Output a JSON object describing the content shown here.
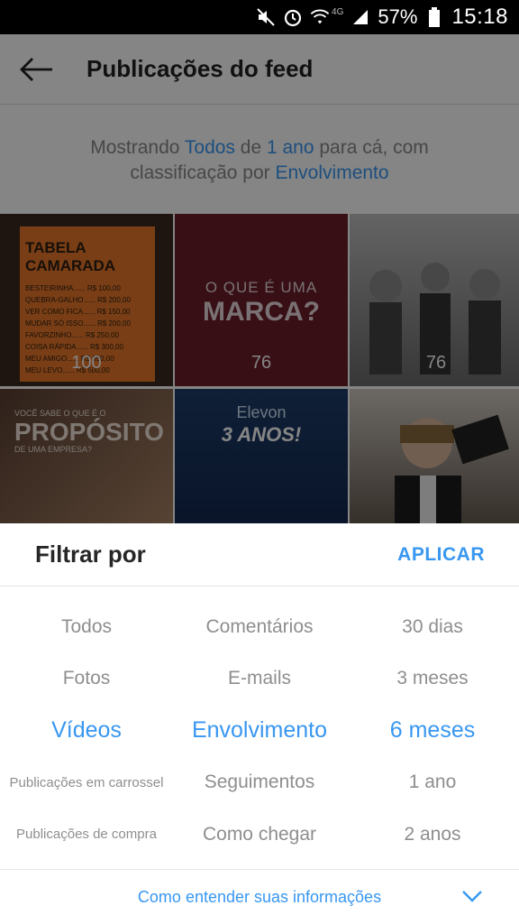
{
  "status_bar": {
    "time": "15:18",
    "battery": "57%",
    "network": "4G",
    "icons": [
      "mute-icon",
      "alarm-icon",
      "wifi-icon",
      "signal-icon",
      "battery-icon"
    ]
  },
  "header": {
    "title": "Publicações do feed",
    "back_icon": "arrow-left-icon"
  },
  "summary": {
    "prefix": "Mostrando ",
    "type": "Todos",
    "middle1": " de ",
    "period": "1 ano",
    "middle2": " para cá, com classificação por ",
    "sort": "Envolvimento"
  },
  "posts": [
    {
      "count": "100",
      "title": "TABELA CAMARADA",
      "rows": [
        "BESTEIRINHA...... R$ 100,00",
        "QUEBRA-GALHO...... R$ 200,00",
        "VER COMO FICA...... R$ 150,00",
        "MUDAR SÓ ISSO...... R$ 200,00",
        "FAVORZINHO...... R$ 250,00",
        "COISA RÁPIDA...... R$ 300,00",
        "MEU AMIGO...... R$ 350,00",
        "MEU LEVO...... R$ 500,00"
      ]
    },
    {
      "count": "76",
      "line1": "O QUE É UMA",
      "line2": "MARCA?"
    },
    {
      "count": "76"
    },
    {
      "line1": "VOCÊ SABE O QUE É O",
      "line2": "PROPÓSITO",
      "line3": "DE UMA EMPRESA?"
    },
    {
      "line1": "Elevon",
      "line2": "3 ANOS!"
    },
    {}
  ],
  "filter_sheet": {
    "title": "Filtrar por",
    "apply_label": "APLICAR",
    "types": [
      "Todos",
      "Fotos",
      "Vídeos",
      "Publicações em carrossel",
      "Publicações de compra"
    ],
    "types_selected": "Vídeos",
    "metrics": [
      "Comentários",
      "E-mails",
      "Envolvimento",
      "Seguimentos",
      "Como chegar"
    ],
    "metrics_selected": "Envolvimento",
    "periods": [
      "30 dias",
      "3 meses",
      "6 meses",
      "1 ano",
      "2 anos"
    ],
    "periods_selected": "6 meses",
    "footer_link": "Como entender suas informações",
    "footer_icon": "chevron-down-icon"
  },
  "colors": {
    "accent": "#3897f0",
    "muted_text": "#8e8e8e",
    "title_text": "#262626"
  }
}
